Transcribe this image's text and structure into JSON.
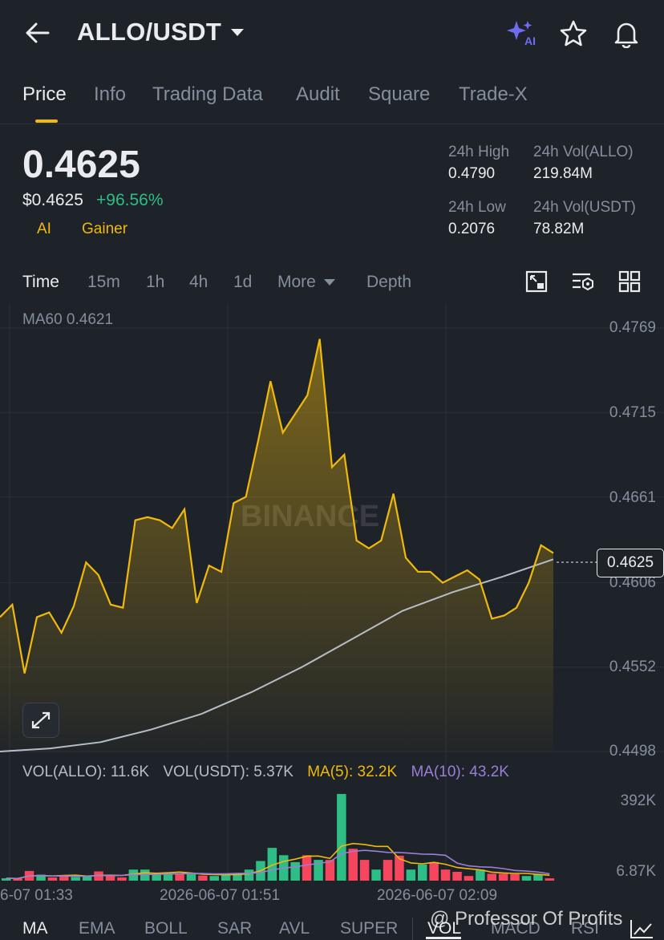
{
  "header": {
    "pair": "ALLO/USDT",
    "icons": [
      "back-arrow-icon",
      "chevron-down-icon",
      "ai-sparkle-icon",
      "star-icon",
      "bell-icon"
    ],
    "ai_badge": "AI"
  },
  "tabs": [
    "Price",
    "Info",
    "Trading Data",
    "Audit",
    "Square",
    "Trade-X"
  ],
  "price": {
    "last": "0.4625",
    "usd": "$0.4625",
    "change": "+96.56%",
    "tags": [
      "AI",
      "Gainer"
    ]
  },
  "stats": {
    "high_label": "24h High",
    "high_value": "0.4790",
    "low_label": "24h Low",
    "low_value": "0.2076",
    "vol_base_label": "24h Vol(ALLO)",
    "vol_base_value": "219.84M",
    "vol_quote_label": "24h Vol(USDT)",
    "vol_quote_value": "78.82M"
  },
  "intervals": [
    "Time",
    "15m",
    "1h",
    "4h",
    "1d",
    "More",
    "Depth"
  ],
  "toolbar_icons": [
    "fullscreen-icon",
    "settings-list-icon",
    "grid-icon"
  ],
  "chart": {
    "ma60_label": "MA60 0.4621",
    "y_labels": [
      "0.4769",
      "0.4715",
      "0.4661",
      "0.4606",
      "0.4552",
      "0.4498"
    ],
    "current_price_tag": "0.4625",
    "watermark_text": "BINANCE",
    "vol_legend": {
      "vol_allo": "VOL(ALLO): 11.6K",
      "vol_usdt": "VOL(USDT): 5.37K",
      "ma5": "MA(5): 32.2K",
      "ma10": "MA(10): 43.2K"
    },
    "vol_y_labels": [
      "392K",
      "6.87K"
    ],
    "x_labels": [
      "6-07 01:33",
      "2026-06-07 01:51",
      "2026-06-07 02:09"
    ],
    "colors": {
      "price_line": "#f0b90b",
      "ma60": "#b7bdc6",
      "up": "#2ebd85",
      "down": "#f6465d",
      "ma5": "#f0b90b",
      "ma10": "#9b7ed6"
    }
  },
  "chart_data": {
    "type": "line",
    "title": "",
    "ylim": [
      0.4498,
      0.479
    ],
    "y_ticks": [
      0.4769,
      0.4715,
      0.4661,
      0.4606,
      0.4552,
      0.4498
    ],
    "x_ticks": [
      "6-07 01:33",
      "2026-06-07 01:51",
      "2026-06-07 02:09"
    ],
    "series": [
      {
        "values": [
          0.4584,
          0.4592,
          0.4548,
          0.4584,
          0.4587,
          0.4574,
          0.4591,
          0.4619,
          0.4611,
          0.4592,
          0.459,
          0.4646,
          0.4648,
          0.4646,
          0.4641,
          0.4653,
          0.4593,
          0.4617,
          0.4613,
          0.4657,
          0.4661,
          0.4697,
          0.4735,
          0.4702,
          0.4714,
          0.4726,
          0.4762,
          0.468,
          0.4688,
          0.4633,
          0.4628,
          0.4633,
          0.4663,
          0.4622,
          0.4613,
          0.4613,
          0.4606,
          0.461,
          0.4614,
          0.4608,
          0.4583,
          0.4585,
          0.459,
          0.4606,
          0.463,
          0.4625
        ]
      },
      {
        "name": "MA60",
        "values": [
          0.4498,
          0.45,
          0.4504,
          0.4512,
          0.4522,
          0.4536,
          0.4552,
          0.457,
          0.4588,
          0.46,
          0.461,
          0.4621
        ]
      }
    ],
    "volume": {
      "ylim": [
        6870,
        392000
      ],
      "bars": [
        {
          "v": 10000,
          "d": "up"
        },
        {
          "v": 9000,
          "d": "down"
        },
        {
          "v": 42000,
          "d": "down"
        },
        {
          "v": 26000,
          "d": "up"
        },
        {
          "v": 14000,
          "d": "down"
        },
        {
          "v": 20000,
          "d": "down"
        },
        {
          "v": 16000,
          "d": "up"
        },
        {
          "v": 22000,
          "d": "up"
        },
        {
          "v": 40000,
          "d": "down"
        },
        {
          "v": 20000,
          "d": "down"
        },
        {
          "v": 14000,
          "d": "down"
        },
        {
          "v": 48000,
          "d": "up"
        },
        {
          "v": 48000,
          "d": "up"
        },
        {
          "v": 30000,
          "d": "up"
        },
        {
          "v": 30000,
          "d": "up"
        },
        {
          "v": 30000,
          "d": "down"
        },
        {
          "v": 28000,
          "d": "up"
        },
        {
          "v": 22000,
          "d": "down"
        },
        {
          "v": 20000,
          "d": "up"
        },
        {
          "v": 28000,
          "d": "up"
        },
        {
          "v": 32000,
          "d": "up"
        },
        {
          "v": 48000,
          "d": "up"
        },
        {
          "v": 85000,
          "d": "up"
        },
        {
          "v": 142000,
          "d": "up"
        },
        {
          "v": 110000,
          "d": "up"
        },
        {
          "v": 80000,
          "d": "up"
        },
        {
          "v": 110000,
          "d": "down"
        },
        {
          "v": 90000,
          "d": "up"
        },
        {
          "v": 90000,
          "d": "down"
        },
        {
          "v": 375000,
          "d": "up"
        },
        {
          "v": 138000,
          "d": "down"
        },
        {
          "v": 90000,
          "d": "down"
        },
        {
          "v": 48000,
          "d": "up"
        },
        {
          "v": 90000,
          "d": "down"
        },
        {
          "v": 108000,
          "d": "down"
        },
        {
          "v": 48000,
          "d": "up"
        },
        {
          "v": 70000,
          "d": "up"
        },
        {
          "v": 80000,
          "d": "down"
        },
        {
          "v": 48000,
          "d": "down"
        },
        {
          "v": 38000,
          "d": "down"
        },
        {
          "v": 20000,
          "d": "down"
        },
        {
          "v": 48000,
          "d": "up"
        },
        {
          "v": 30000,
          "d": "down"
        },
        {
          "v": 30000,
          "d": "down"
        },
        {
          "v": 28000,
          "d": "down"
        },
        {
          "v": 20000,
          "d": "up"
        },
        {
          "v": 28000,
          "d": "up"
        },
        {
          "v": 10000,
          "d": "down"
        }
      ]
    }
  },
  "indicators": [
    "MA",
    "EMA",
    "BOLL",
    "SAR",
    "AVL",
    "SUPER",
    "VOL",
    "MACD",
    "RSI"
  ],
  "watermark": "@ Professor Of Profits"
}
